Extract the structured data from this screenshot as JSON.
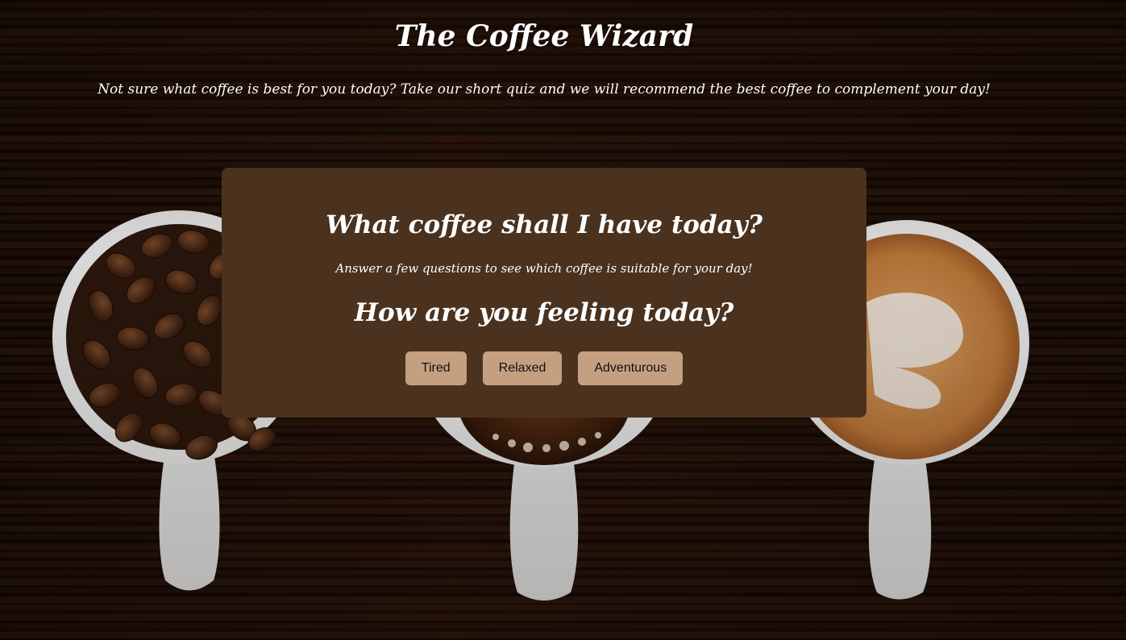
{
  "header": {
    "title": "The Coffee Wizard",
    "subtitle": "Not sure what coffee is best for you today? Take our short quiz and we will recommend the best coffee to complement your day!"
  },
  "quiz": {
    "title": "What coffee shall I have today?",
    "intro": "Answer a few questions to see which coffee is suitable for your day!",
    "question": "How are you feeling today?",
    "answers": [
      "Tired",
      "Relaxed",
      "Adventurous"
    ]
  },
  "colors": {
    "card_background": "#4a321f",
    "button_background": "#c4a081",
    "text": "#ffffff"
  }
}
